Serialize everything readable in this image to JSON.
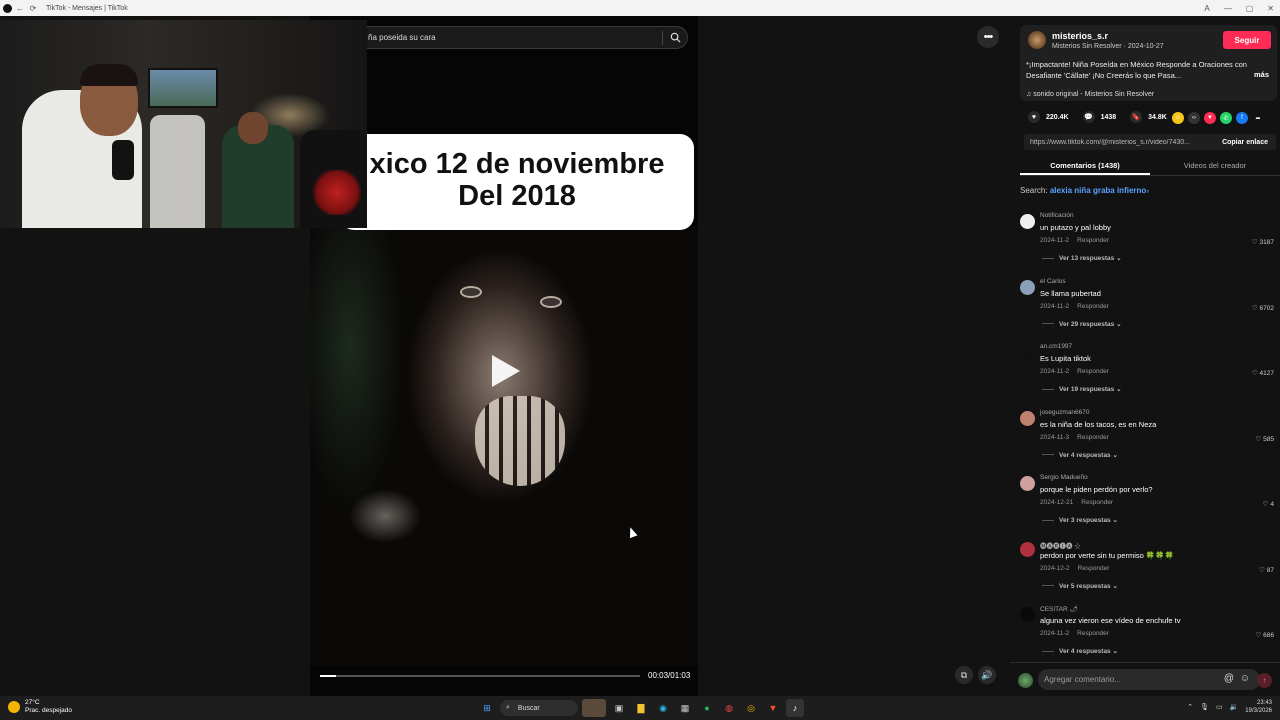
{
  "browser": {
    "title": "TikTok - Mensajes | TikTok",
    "icons": [
      "back-icon",
      "refresh-icon"
    ]
  },
  "search": {
    "query": "ña poseida su cara"
  },
  "video": {
    "caption_line1": "xico 12 de noviembre",
    "caption_line2": "Del 2018",
    "time": "00:03/01:03",
    "progress_fraction": 0.05
  },
  "author": {
    "username": "misterios_s.r",
    "display": "Misterios Sin Resolver · 2024-10-27",
    "follow_label": "Seguir",
    "description": "*¡Impactante! Niña Poseída en México Responde a Oraciones con Desafiante 'Cállate' ¡No Creerás lo que Pasa...",
    "more_label": "más",
    "sound": "sonido original - Misterios Sin Resolver"
  },
  "stats": {
    "likes": "220.4K",
    "comments": "1438",
    "saves": "34.8K"
  },
  "link": {
    "url": "https://www.tiktok.com/@misterios_s.r/video/7430...",
    "copy_label": "Copiar enlace"
  },
  "tabs": [
    "Comentarios (1438)",
    "Videos del creador"
  ],
  "search_suggest": {
    "label": "Search:",
    "term": "alexia niña graba infierno"
  },
  "comments": [
    {
      "user": "Notificación",
      "text": "un putazo y pal lobby",
      "date": "2024-11-2",
      "reply": "Responder",
      "likes": "3187",
      "replies": "Ver 13 respuestas",
      "avatar_color": "#f0f0f0"
    },
    {
      "user": "el Carlos",
      "text": "Se llama pubertad",
      "date": "2024-11-2",
      "reply": "Responder",
      "likes": "6702",
      "replies": "Ver 29 respuestas",
      "avatar_color": "#8aa0b8"
    },
    {
      "user": "an.cm1997",
      "text": "Es Lupita tiktok",
      "date": "2024-11-2",
      "reply": "Responder",
      "likes": "4127",
      "replies": "Ver 19 respuestas",
      "avatar_color": "#111111"
    },
    {
      "user": "joseguzman6670",
      "text": "es la niña de los tacos, es en Neza",
      "date": "2024-11-3",
      "reply": "Responder",
      "likes": "585",
      "replies": "Ver 4 respuestas",
      "avatar_color": "#c08070"
    },
    {
      "user": "Sergio Madueño",
      "text": "porque le piden perdón por verlo?",
      "date": "2024-12-21",
      "reply": "Responder",
      "likes": "4",
      "replies": "Ver 3 respuestas",
      "avatar_color": "#d0a0a0"
    },
    {
      "user": "🅜🅐🅡🅘🅐 ☆",
      "text": "perdon por verte sin tu permiso 🍀🍀🍀",
      "date": "2024-12-2",
      "reply": "Responder",
      "likes": "87",
      "replies": "Ver 5 respuestas",
      "avatar_color": "#b03040"
    },
    {
      "user": "CESITAR 🌶",
      "text": "alguna vez vieron ese vídeo de enchufe tv",
      "date": "2024-11-2",
      "reply": "Responder",
      "likes": "686",
      "replies": "Ver 4 respuestas",
      "avatar_color": "#0a0a0a"
    }
  ],
  "comment_bar": {
    "placeholder": "Agregar comentario..."
  },
  "taskbar": {
    "temp": "27°C",
    "weather": "Prac. despejado",
    "search_label": "Buscar",
    "time": "23:43",
    "date": "19/3/2026"
  },
  "colors": {
    "accent": "#fe2c55",
    "link": "#5aa2ff"
  }
}
